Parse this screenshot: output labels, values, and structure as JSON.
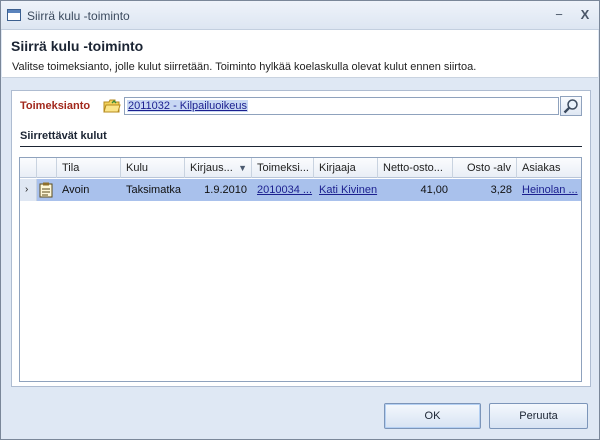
{
  "window": {
    "title": "Siirrä kulu -toiminto",
    "minimize_label": "−",
    "close_label": "X"
  },
  "header": {
    "title": "Siirrä kulu -toiminto",
    "description": "Valitse toimeksianto, jolle kulut siirretään. Toiminto hylkää koelaskulla olevat kulut ennen siirtoa."
  },
  "assignment": {
    "label": "Toimeksianto",
    "value": "2011032 - Kilpailuoikeus",
    "folder_icon": "folder-icon",
    "search_icon": "search-icon"
  },
  "section": {
    "title": "Siirrettävät kulut"
  },
  "grid": {
    "columns": [
      "Tila",
      "Kulu",
      "Kirjaus...",
      "Toimeksi...",
      "Kirjaaja",
      "Netto-osto...",
      "Osto -alv",
      "Asiakas"
    ],
    "sort_indicator": "▼",
    "rows": [
      {
        "indicator": "›",
        "tila": "Avoin",
        "kulu": "Taksimatka",
        "kirjaus": "1.9.2010",
        "toimeksianto": "2010034 ...",
        "kirjaaja": "Kati Kivinen",
        "netto": "41,00",
        "alv": "3,28",
        "asiakas": "Heinolan ..."
      }
    ]
  },
  "buttons": {
    "ok": "OK",
    "cancel": "Peruuta"
  },
  "colors": {
    "label_accent": "#a2281c",
    "selected_row": "#a9c1ec",
    "link": "#1b1f8f"
  }
}
